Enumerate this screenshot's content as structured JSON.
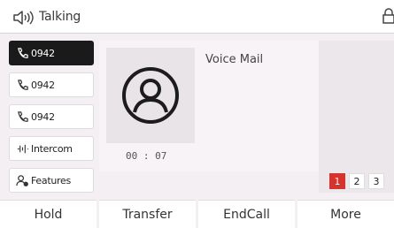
{
  "status": {
    "icon": "speaker-icon",
    "title": "Talking",
    "lock_icon": "lock-icon"
  },
  "line_keys": [
    {
      "icon": "phone-icon",
      "label": "0942",
      "active": true
    },
    {
      "icon": "phone-icon",
      "label": "0942",
      "active": false
    },
    {
      "icon": "phone-icon",
      "label": "0942",
      "active": false
    },
    {
      "icon": "intercom-icon",
      "label": "Intercom",
      "active": false
    },
    {
      "icon": "features-icon",
      "label": "Features",
      "active": false
    }
  ],
  "call": {
    "avatar_icon": "person-avatar-icon",
    "callee": "Voice Mail",
    "duration": "00 : 07"
  },
  "pages": [
    {
      "label": "1",
      "active": true
    },
    {
      "label": "2",
      "active": false
    },
    {
      "label": "3",
      "active": false
    }
  ],
  "softkeys": [
    "Hold",
    "Transfer",
    "EndCall",
    "More"
  ],
  "colors": {
    "active_line_key": "#1a1a1a",
    "active_page": "#d7322c"
  }
}
